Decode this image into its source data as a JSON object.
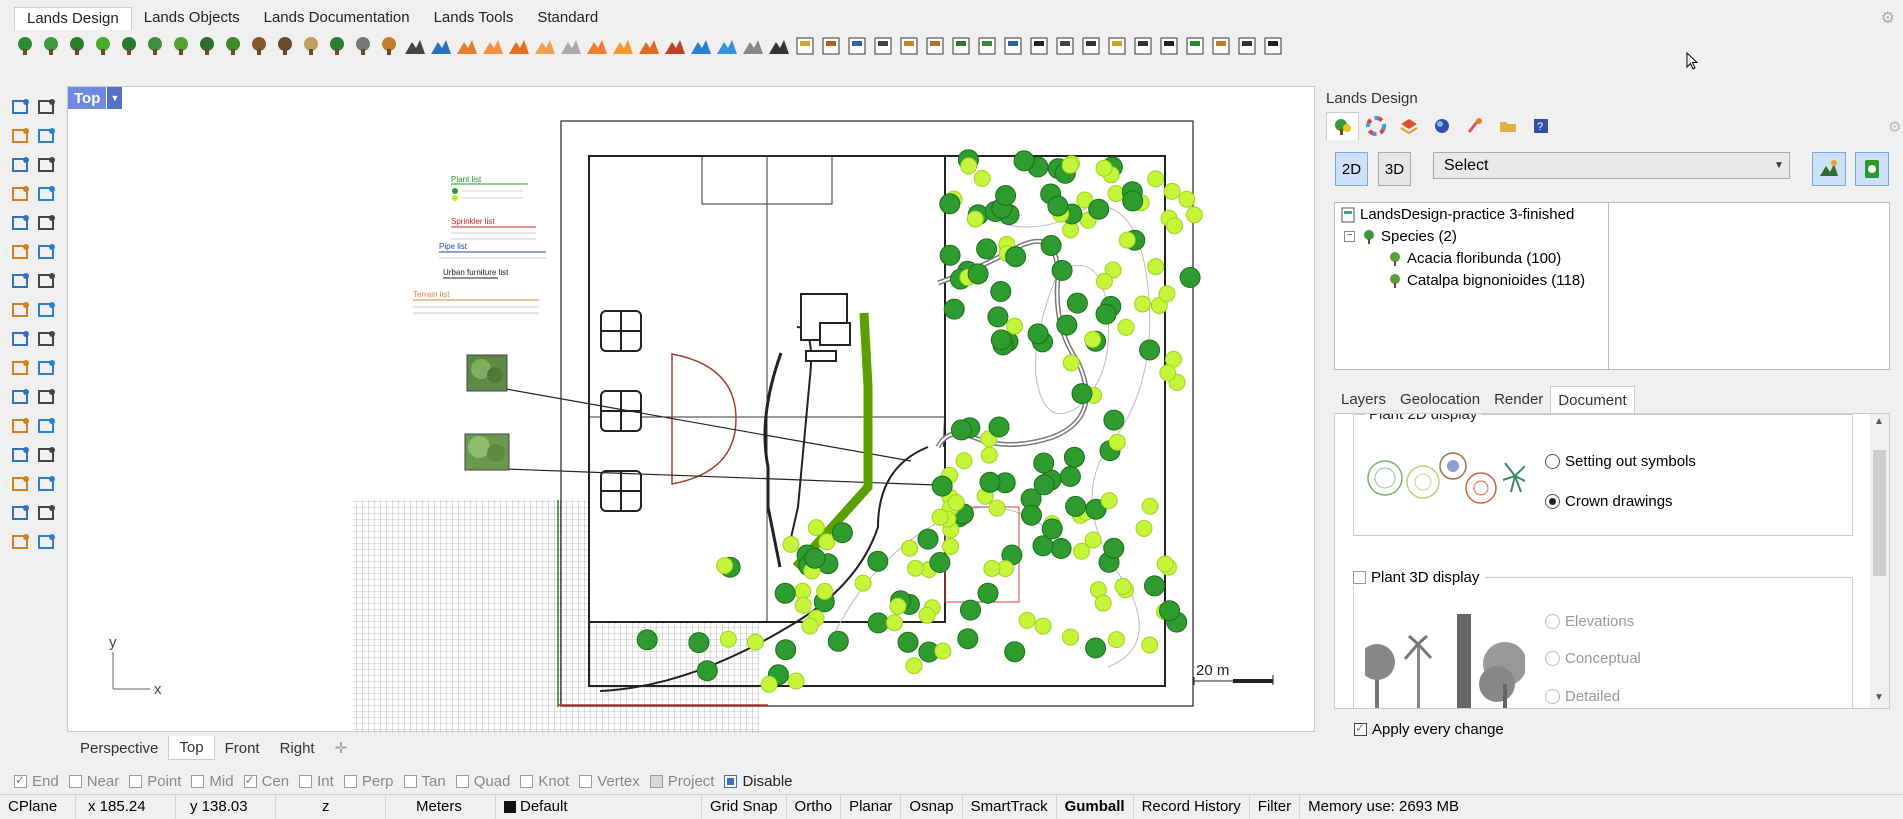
{
  "ribbon": {
    "tabs": [
      "Lands Design",
      "Lands Objects",
      "Lands Documentation",
      "Lands Tools",
      "Standard"
    ]
  },
  "viewport": {
    "active_view": "Top",
    "scale_label": "20 m",
    "axis_x": "x",
    "axis_y": "y",
    "plan_lists": {
      "plant_list": "Plant list",
      "sprinkler_list": "Sprinkler list",
      "pipe_list": "Pipe list",
      "urban_furniture_list": "Urban furniture list",
      "terrain_list": "Terrain list"
    }
  },
  "view_tabs": [
    "Perspective",
    "Top",
    "Front",
    "Right"
  ],
  "osnaps": [
    {
      "label": "End",
      "checked": true
    },
    {
      "label": "Near",
      "checked": false
    },
    {
      "label": "Point",
      "checked": false
    },
    {
      "label": "Mid",
      "checked": false
    },
    {
      "label": "Cen",
      "checked": true
    },
    {
      "label": "Int",
      "checked": false
    },
    {
      "label": "Perp",
      "checked": false
    },
    {
      "label": "Tan",
      "checked": false
    },
    {
      "label": "Quad",
      "checked": false
    },
    {
      "label": "Knot",
      "checked": false
    },
    {
      "label": "Vertex",
      "checked": false
    },
    {
      "label": "Project",
      "checked": false
    }
  ],
  "osnap_disable": "Disable",
  "status": {
    "cplane": "CPlane",
    "x": "x 185.24",
    "y": "y 138.03",
    "z": "z",
    "units": "Meters",
    "layer": "Default",
    "grid_snap": "Grid Snap",
    "ortho": "Ortho",
    "planar": "Planar",
    "osnap": "Osnap",
    "smarttrack": "SmartTrack",
    "gumball": "Gumball",
    "record_history": "Record History",
    "filter": "Filter",
    "memory": "Memory use: 2693 MB"
  },
  "panel": {
    "title": "Lands Design",
    "mode_2d": "2D",
    "mode_3d": "3D",
    "select_value": "Select",
    "tree": {
      "root": "LandsDesign-practice 3-finished",
      "species": "Species (2)",
      "items": [
        "Acacia floribunda  (100)",
        "Catalpa bignonioides  (118)"
      ]
    },
    "tabs": [
      "Layers",
      "Geolocation",
      "Render",
      "Document"
    ],
    "active_tab": "Document",
    "plant2d": {
      "title": "Plant 2D display",
      "options": [
        "Setting out symbols",
        "Crown drawings"
      ],
      "selected": "Crown drawings"
    },
    "plant3d": {
      "title": "Plant 3D display",
      "checked": false,
      "options": [
        "Elevations",
        "Conceptual",
        "Detailed"
      ]
    },
    "apply_every_change": "Apply every change",
    "apply_checked": true
  },
  "colors": {
    "viewport_label_bg": "#6f8ae0",
    "accent_green": "#2e9b2e",
    "lime": "#b6f21a"
  }
}
